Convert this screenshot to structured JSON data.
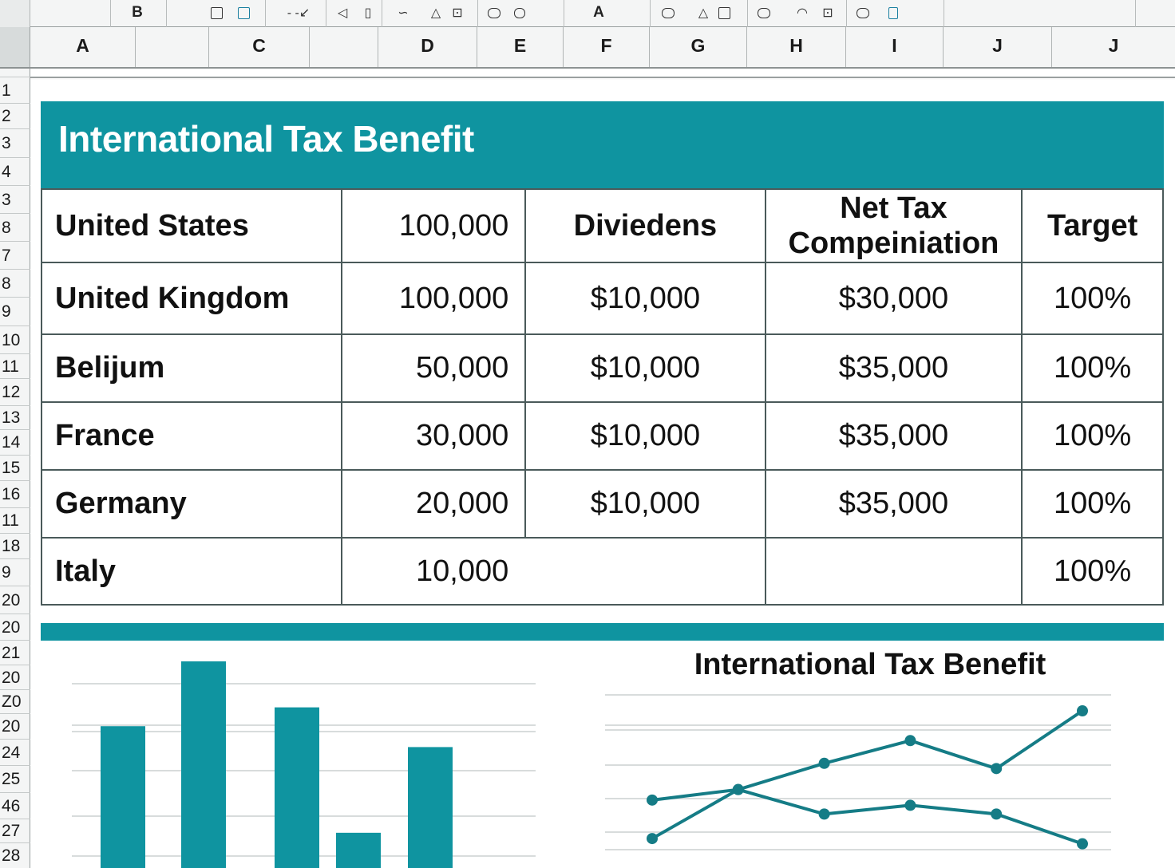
{
  "toolbar": {
    "letters": [
      "B",
      "A"
    ],
    "icons": [
      "square-icon",
      "square-blue-icon",
      "dash-arrow-icon",
      "back-shape-icon",
      "doc-icon",
      "curve-icon",
      "triangle-icon",
      "book-icon",
      "chip-icon",
      "rounded-rect-icon",
      "rounded-shape-icon",
      "triangle-icon",
      "square-icon",
      "chip-icon",
      "half-circle-icon",
      "book-icon",
      "chip-icon",
      "phone-icon"
    ]
  },
  "columns": [
    "A",
    "C",
    "D",
    "E",
    "F",
    "G",
    "H",
    "I",
    "J",
    "J"
  ],
  "rows": [
    "1",
    "2",
    "3",
    "4",
    "3",
    "8",
    "7",
    "8",
    "9",
    "10",
    "11",
    "12",
    "13",
    "14",
    "15",
    "16",
    "11",
    "18",
    "9",
    "20",
    "20",
    "21",
    "20",
    "Z0",
    "20",
    "24",
    "25",
    "46",
    "27",
    "28"
  ],
  "sheet": {
    "title": "International Tax Benefit",
    "table": {
      "header_row": {
        "country": "United States",
        "value": "100,000",
        "col3": "Diviedens",
        "col4_line1": "Net Tax",
        "col4_line2": "Compeiniation",
        "col5": "Target"
      },
      "rows": [
        {
          "country": "United Kingdom",
          "value": "100,000",
          "dividends": "$10,000",
          "net": "$30,000",
          "target": "100%"
        },
        {
          "country": "Belijum",
          "value": "50,000",
          "dividends": "$10,000",
          "net": "$35,000",
          "target": "100%"
        },
        {
          "country": "France",
          "value": "30,000",
          "dividends": "$10,000",
          "net": "$35,000",
          "target": "100%"
        },
        {
          "country": "Germany",
          "value": "20,000",
          "dividends": "$10,000",
          "net": "$35,000",
          "target": "100%"
        },
        {
          "country": "Italy",
          "value": "10,000",
          "dividends": "",
          "net": "",
          "target": "100%"
        }
      ]
    }
  },
  "colors": {
    "accent": "#0f94a0",
    "chart_bar": "#0f94a0",
    "chart_line": "#157c86",
    "grid": "#d8dcdc"
  },
  "chart_data": [
    {
      "type": "bar",
      "categories": [
        "",
        "",
        "",
        "",
        ""
      ],
      "values": [
        69,
        100,
        78,
        18,
        59
      ],
      "title": "",
      "grid": true
    },
    {
      "type": "line",
      "title": "International Tax Benefit",
      "x": [
        1,
        2,
        3,
        4,
        5,
        6
      ],
      "series": [
        {
          "values": [
            32,
            38,
            53,
            66,
            50,
            83
          ]
        },
        {
          "values": [
            10,
            38,
            24,
            29,
            24,
            7
          ]
        }
      ],
      "grid": true
    }
  ]
}
